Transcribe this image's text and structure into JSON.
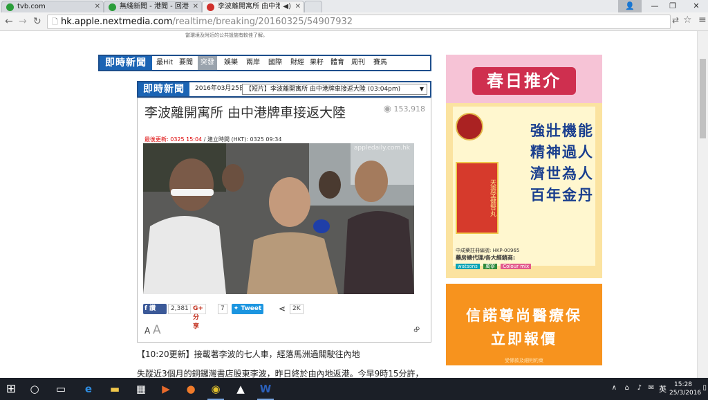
{
  "browser": {
    "tabs": [
      {
        "title": "tvb.com",
        "favicon_color": "#2a9d3a"
      },
      {
        "title": "無綫新聞 - 港聞 - 回港",
        "favicon_color": "#2a9d3a"
      },
      {
        "title": "李波離開寓所 由中港車",
        "favicon_color": "#d0312d",
        "audio": "◀)",
        "active": true
      }
    ],
    "url_host": "hk.apple.nextmedia.com",
    "url_path": "/realtime/breaking/20160325/54907932"
  },
  "page": {
    "top_notice": "當環境及附近的公共設施有較佳了解。",
    "brand": "即時新聞",
    "nav_items": [
      "最Hit",
      "要聞",
      "突發",
      "娛樂",
      "兩岸",
      "國際",
      "財經",
      "果籽",
      "體育",
      "周刊",
      "賽馬"
    ],
    "nav_selected": "突發",
    "sub_brand": "即時新聞",
    "date": "2016年03月25日",
    "dropdown_value": "【短片】李波離開寓所 由中港牌車接返大陸 (03:04pm)",
    "headline": "李波離開寓所 由中港牌車接返大陸",
    "views": "153,918",
    "update_label": "最後更新: 0325 15:04",
    "created_label": " / 建立時間 (HKT): 0325 09:34",
    "photo_watermark": "appledaily.com.hk",
    "share": {
      "fb_label": "讚",
      "fb_count": "2,381",
      "gplus_label": "G+ 分享",
      "gplus_count": "7",
      "tweet_label": "Tweet",
      "share_count": "2K"
    },
    "font_size_labels": [
      "A",
      "A"
    ],
    "paragraphs": [
      "【10:20更新】接載著李波的七人車，經落馬洲過關駛往內地",
      "失蹤近3個月的銅鑼灣書店股東李波，昨日終於由內地返港。今早9時15分許，"
    ]
  },
  "ad1": {
    "banner": "春日推介",
    "lines": [
      "強壯機能",
      "精神過人",
      "濟世為人",
      "百年金丹"
    ],
    "product_label": "天壽堂健腎丸",
    "footer_text": "中成藥註冊編號: HKP-00965",
    "footer_text2": "藥房總代理/各大經銷商:",
    "stores": [
      "watsons",
      "萬寧",
      "Colour mix"
    ]
  },
  "ad2": {
    "line1": "信諾尊尚醫療保",
    "line2": "立即報價",
    "fine": "受條款及細則約束"
  },
  "taskbar": {
    "time": "15:28",
    "date": "25/3/2016",
    "ime": "英"
  }
}
